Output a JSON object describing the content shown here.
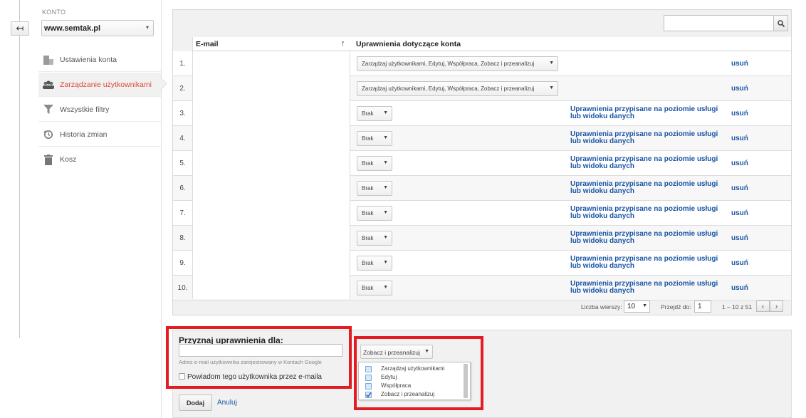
{
  "sidebar": {
    "konto_label": "KONTO",
    "account": "www.semtak.pl",
    "items": [
      {
        "label": "Ustawienia konta",
        "icon": "building-icon"
      },
      {
        "label": "Zarządzanie użytkownikami",
        "icon": "users-icon",
        "active": true
      },
      {
        "label": "Wszystkie filtry",
        "icon": "filter-icon"
      },
      {
        "label": "Historia zmian",
        "icon": "history-icon"
      },
      {
        "label": "Kosz",
        "icon": "trash-icon"
      }
    ]
  },
  "table": {
    "search_value": "",
    "headers": {
      "email": "E-mail",
      "permissions": "Uprawnienia dotyczące konta"
    },
    "sort_icon": "arrow-up-icon",
    "rows": [
      {
        "num": "1.",
        "permission": "Zarządzaj użytkownikami, Edytuj, Współpraca, Zobacz i przeanalizuj",
        "service_note": "",
        "remove": "usuń"
      },
      {
        "num": "2.",
        "permission": "Zarządzaj użytkownikami, Edytuj, Współpraca, Zobacz i przeanalizuj",
        "service_note": "",
        "remove": "usuń"
      },
      {
        "num": "3.",
        "permission": "Brak",
        "service_note": "Uprawnienia przypisane na poziomie usługi lub widoku danych",
        "remove": "usuń"
      },
      {
        "num": "4.",
        "permission": "Brak",
        "service_note": "Uprawnienia przypisane na poziomie usługi lub widoku danych",
        "remove": "usuń"
      },
      {
        "num": "5.",
        "permission": "Brak",
        "service_note": "Uprawnienia przypisane na poziomie usługi lub widoku danych",
        "remove": "usuń"
      },
      {
        "num": "6.",
        "permission": "Brak",
        "service_note": "Uprawnienia przypisane na poziomie usługi lub widoku danych",
        "remove": "usuń"
      },
      {
        "num": "7.",
        "permission": "Brak",
        "service_note": "Uprawnienia przypisane na poziomie usługi lub widoku danych",
        "remove": "usuń"
      },
      {
        "num": "8.",
        "permission": "Brak",
        "service_note": "Uprawnienia przypisane na poziomie usługi lub widoku danych",
        "remove": "usuń"
      },
      {
        "num": "9.",
        "permission": "Brak",
        "service_note": "Uprawnienia przypisane na poziomie usługi lub widoku danych",
        "remove": "usuń"
      },
      {
        "num": "10.",
        "permission": "Brak",
        "service_note": "Uprawnienia przypisane na poziomie usługi lub widoku danych",
        "remove": "usuń"
      }
    ],
    "pager": {
      "rows_label": "Liczba wierszy:",
      "rows_value": "10",
      "goto_label": "Przejdź do:",
      "goto_value": "1",
      "range": "1 – 10 z 51",
      "prev": "‹",
      "next": "›"
    }
  },
  "grant": {
    "title": "Przyznaj uprawnienia dla:",
    "email_value": "",
    "help": "Adres e-mail użytkownika zarejestrowany w Kontach Google",
    "notify_label": "Powiadom tego użytkownika przez e-maila",
    "add_label": "Dodaj",
    "cancel_label": "Anuluj",
    "role_selected": "Zobacz i przeanalizuj",
    "role_options": [
      {
        "label": "Zarządzaj użytkownikami",
        "checked": false
      },
      {
        "label": "Edytuj",
        "checked": false
      },
      {
        "label": "Współpraca",
        "checked": false
      },
      {
        "label": "Zobacz i przeanalizuj",
        "checked": true
      }
    ]
  },
  "colors": {
    "accent_red": "#e31b23",
    "active_nav": "#dd4b39",
    "link": "#1a55a5"
  }
}
